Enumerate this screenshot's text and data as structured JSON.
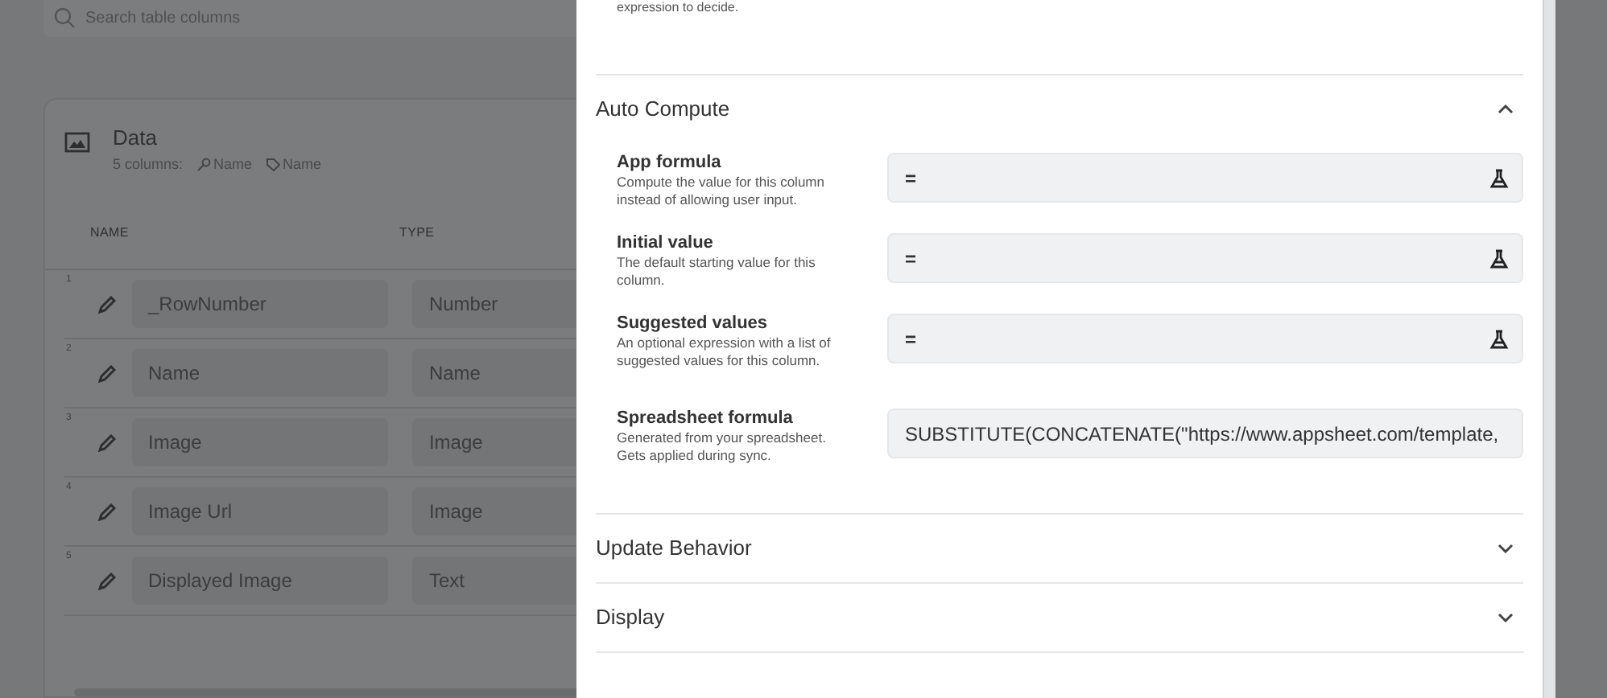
{
  "search": {
    "placeholder": "Search table columns"
  },
  "table": {
    "title": "Data",
    "subtitle": "5 columns:",
    "key_column": "Name",
    "label_column": "Name",
    "columns": [
      "NAME",
      "TYPE"
    ],
    "rows": [
      {
        "number": "1",
        "name": "_RowNumber",
        "type": "Number"
      },
      {
        "number": "2",
        "name": "Name",
        "type": "Name"
      },
      {
        "number": "3",
        "name": "Image",
        "type": "Image"
      },
      {
        "number": "4",
        "name": "Image Url",
        "type": "Image"
      },
      {
        "number": "5",
        "name": "Displayed Image",
        "type": "Text"
      }
    ]
  },
  "panel": {
    "top_text": "expression to decide.",
    "sections": [
      {
        "title": "Auto Compute",
        "expanded": true,
        "fields": [
          {
            "label": "App formula",
            "help": "Compute the value for this column instead of allowing user input.",
            "value": "=",
            "kind": "expression"
          },
          {
            "label": "Initial value",
            "help": "The default starting value for this column.",
            "value": "=",
            "kind": "expression"
          },
          {
            "label": "Suggested values",
            "help": "An optional expression with a list of suggested values for this column.",
            "value": "=",
            "kind": "expression"
          },
          {
            "label": "Spreadsheet formula",
            "help": "Generated from your spreadsheet. Gets applied during sync.",
            "value": "SUBSTITUTE(CONCATENATE(\"https://www.appsheet.com/template,",
            "kind": "readonly"
          }
        ]
      },
      {
        "title": "Update Behavior",
        "expanded": false
      },
      {
        "title": "Display",
        "expanded": false
      }
    ]
  }
}
